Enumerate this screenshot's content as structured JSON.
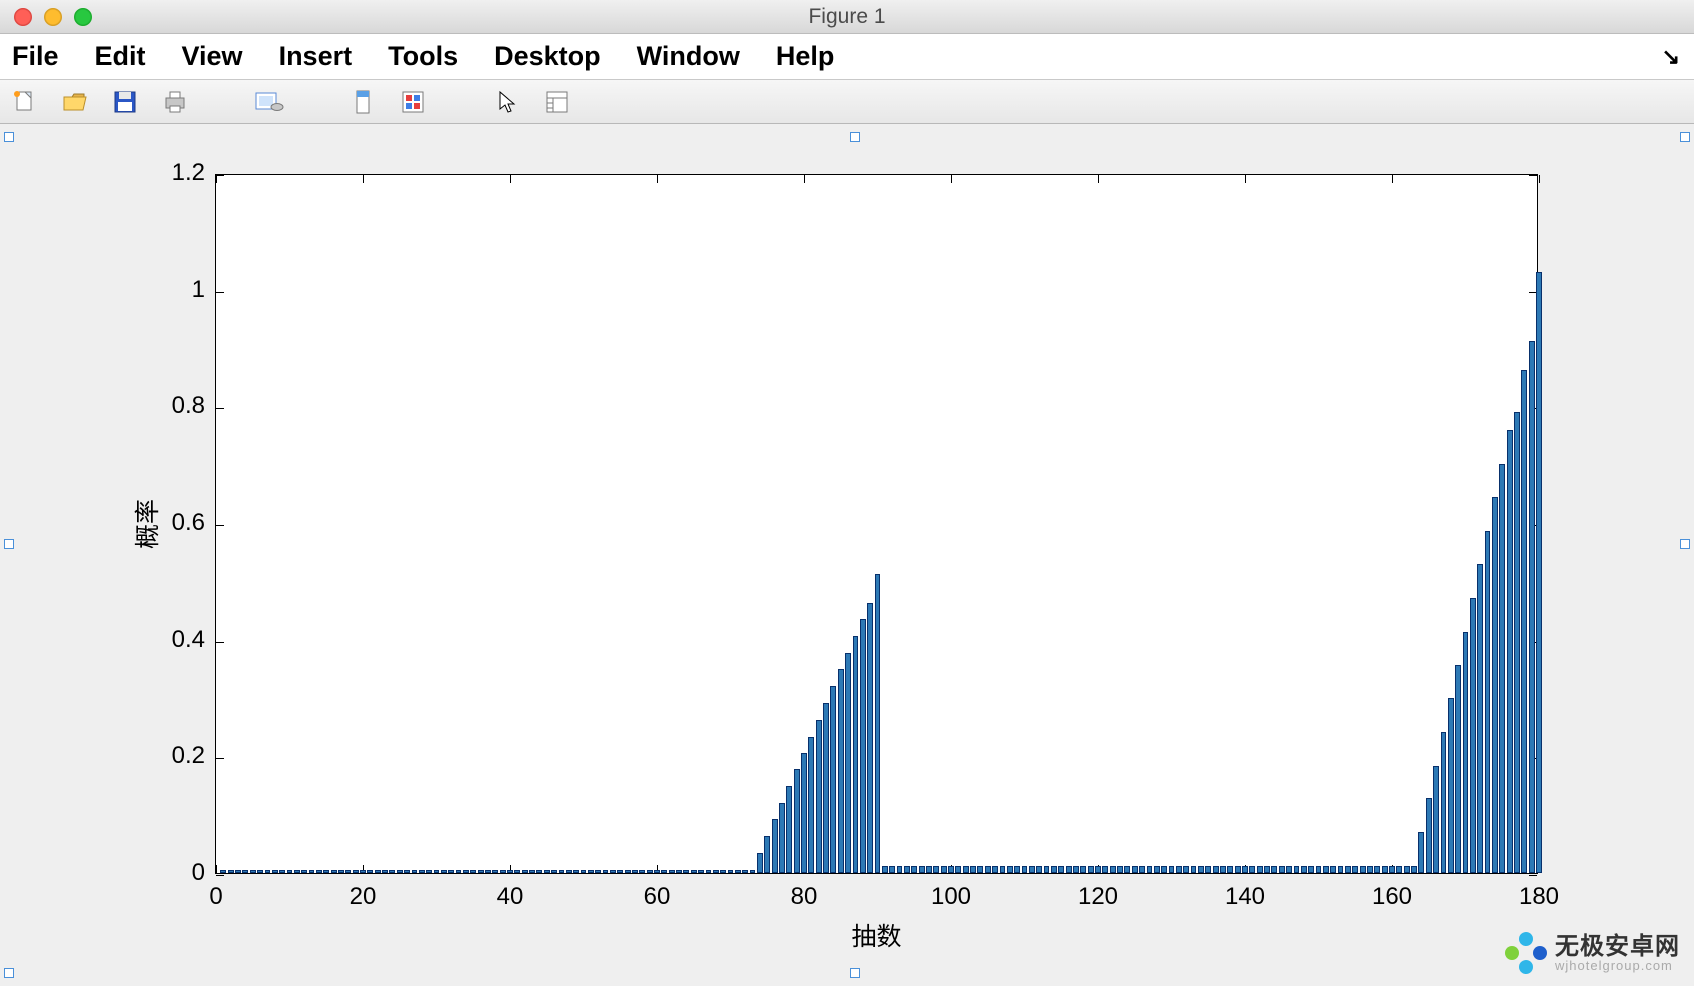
{
  "window": {
    "title": "Figure 1"
  },
  "menubar": {
    "items": [
      "File",
      "Edit",
      "View",
      "Insert",
      "Tools",
      "Desktop",
      "Window",
      "Help"
    ]
  },
  "toolbar": {
    "icons": [
      "new-file-icon",
      "open-file-icon",
      "save-icon",
      "print-icon",
      "page-setup-icon",
      "data-cursor-icon",
      "colorbar-icon",
      "pointer-icon",
      "plot-tools-icon"
    ]
  },
  "chart_data": {
    "type": "bar",
    "xlabel": "抽数",
    "ylabel": "概率",
    "xlim": [
      0,
      180
    ],
    "ylim": [
      0,
      1.2
    ],
    "xticks": [
      0,
      20,
      40,
      60,
      80,
      100,
      120,
      140,
      160,
      180
    ],
    "yticks": [
      0,
      0.2,
      0.4,
      0.6,
      0.8,
      1,
      1.2
    ],
    "ytick_labels": [
      "0",
      "0.2",
      "0.4",
      "0.6",
      "0.8",
      "1",
      "1.2"
    ],
    "x": [
      1,
      2,
      3,
      4,
      5,
      6,
      7,
      8,
      9,
      10,
      11,
      12,
      13,
      14,
      15,
      16,
      17,
      18,
      19,
      20,
      21,
      22,
      23,
      24,
      25,
      26,
      27,
      28,
      29,
      30,
      31,
      32,
      33,
      34,
      35,
      36,
      37,
      38,
      39,
      40,
      41,
      42,
      43,
      44,
      45,
      46,
      47,
      48,
      49,
      50,
      51,
      52,
      53,
      54,
      55,
      56,
      57,
      58,
      59,
      60,
      61,
      62,
      63,
      64,
      65,
      66,
      67,
      68,
      69,
      70,
      71,
      72,
      73,
      74,
      75,
      76,
      77,
      78,
      79,
      80,
      81,
      82,
      83,
      84,
      85,
      86,
      87,
      88,
      89,
      90,
      91,
      92,
      93,
      94,
      95,
      96,
      97,
      98,
      99,
      100,
      101,
      102,
      103,
      104,
      105,
      106,
      107,
      108,
      109,
      110,
      111,
      112,
      113,
      114,
      115,
      116,
      117,
      118,
      119,
      120,
      121,
      122,
      123,
      124,
      125,
      126,
      127,
      128,
      129,
      130,
      131,
      132,
      133,
      134,
      135,
      136,
      137,
      138,
      139,
      140,
      141,
      142,
      143,
      144,
      145,
      146,
      147,
      148,
      149,
      150,
      151,
      152,
      153,
      154,
      155,
      156,
      157,
      158,
      159,
      160,
      161,
      162,
      163,
      164,
      165,
      166,
      167,
      168,
      169,
      170,
      171,
      172,
      173,
      174,
      175,
      176,
      177,
      178,
      179,
      180
    ],
    "y": [
      0.006,
      0.006,
      0.006,
      0.006,
      0.006,
      0.006,
      0.006,
      0.006,
      0.006,
      0.006,
      0.006,
      0.006,
      0.006,
      0.006,
      0.006,
      0.006,
      0.006,
      0.006,
      0.006,
      0.006,
      0.006,
      0.006,
      0.006,
      0.006,
      0.006,
      0.006,
      0.006,
      0.006,
      0.006,
      0.006,
      0.006,
      0.006,
      0.006,
      0.006,
      0.006,
      0.006,
      0.006,
      0.006,
      0.006,
      0.006,
      0.006,
      0.006,
      0.006,
      0.006,
      0.006,
      0.006,
      0.006,
      0.006,
      0.006,
      0.006,
      0.006,
      0.006,
      0.006,
      0.006,
      0.006,
      0.006,
      0.006,
      0.006,
      0.006,
      0.006,
      0.006,
      0.006,
      0.006,
      0.006,
      0.006,
      0.006,
      0.006,
      0.006,
      0.006,
      0.006,
      0.006,
      0.006,
      0.006,
      0.035,
      0.064,
      0.093,
      0.12,
      0.149,
      0.178,
      0.206,
      0.234,
      0.263,
      0.292,
      0.32,
      0.349,
      0.378,
      0.406,
      0.435,
      0.463,
      0.512,
      0.012,
      0.012,
      0.012,
      0.012,
      0.012,
      0.012,
      0.012,
      0.012,
      0.012,
      0.012,
      0.012,
      0.012,
      0.012,
      0.012,
      0.012,
      0.012,
      0.012,
      0.012,
      0.012,
      0.012,
      0.012,
      0.012,
      0.012,
      0.012,
      0.012,
      0.012,
      0.012,
      0.012,
      0.012,
      0.012,
      0.012,
      0.012,
      0.012,
      0.012,
      0.012,
      0.012,
      0.012,
      0.012,
      0.012,
      0.012,
      0.012,
      0.012,
      0.012,
      0.012,
      0.012,
      0.012,
      0.012,
      0.012,
      0.012,
      0.012,
      0.012,
      0.012,
      0.012,
      0.012,
      0.012,
      0.012,
      0.012,
      0.012,
      0.012,
      0.012,
      0.012,
      0.012,
      0.012,
      0.012,
      0.012,
      0.012,
      0.012,
      0.012,
      0.012,
      0.012,
      0.012,
      0.012,
      0.012,
      0.07,
      0.128,
      0.184,
      0.242,
      0.3,
      0.357,
      0.414,
      0.472,
      0.53,
      0.587,
      0.644,
      0.702,
      0.76,
      0.79,
      0.862,
      0.912,
      1.03
    ]
  },
  "watermark": {
    "main": "无极安卓网",
    "sub": "wjhotelgroup.com"
  }
}
